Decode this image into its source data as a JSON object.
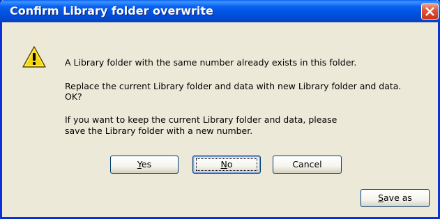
{
  "dialog": {
    "title": "Confirm Library folder overwrite",
    "messages": {
      "line1": "A Library folder with the same number already exists in this folder.",
      "line2a": "Replace the current Library folder and data with new Library folder and data.",
      "line2b": "OK?",
      "line3a": "If you want to keep the current Library folder and data, please",
      "line3b": "save the Library folder with a new number."
    },
    "buttons": {
      "yes_mnemonic": "Y",
      "yes_rest": "es",
      "no_mnemonic": "N",
      "no_rest": "o",
      "cancel": "Cancel",
      "saveas_mnemonic": "S",
      "saveas_rest": "ave as"
    },
    "icons": {
      "warning": "warning-icon",
      "close": "close-icon"
    },
    "colors": {
      "titlebar": "#0054e3",
      "close_button": "#e2553a",
      "body": "#ece9d8",
      "warning": "#f5d80c"
    }
  }
}
